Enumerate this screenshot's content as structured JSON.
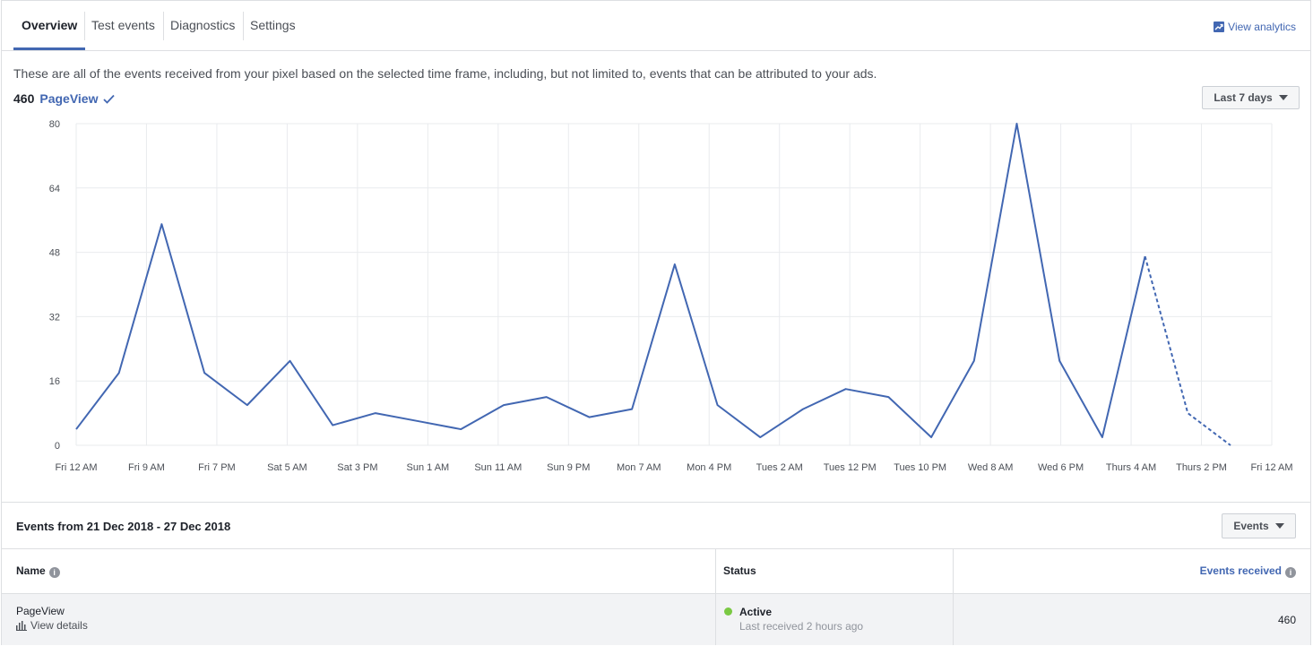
{
  "tabs": [
    {
      "label": "Overview",
      "active": true
    },
    {
      "label": "Test events",
      "active": false
    },
    {
      "label": "Diagnostics",
      "active": false
    },
    {
      "label": "Settings",
      "active": false
    }
  ],
  "header": {
    "view_analytics": "View analytics"
  },
  "description": "These are all of the events received from your pixel based on the selected time frame, including, but not limited to, events that can be attributed to your ads.",
  "summary": {
    "count": "460",
    "event": "PageView"
  },
  "timeframe_button": "Last 7 days",
  "accent_color": "#4267b2",
  "chart_data": {
    "type": "line",
    "x_tick_labels": [
      "Fri 12 AM",
      "Fri 9 AM",
      "Fri 7 PM",
      "Sat 5 AM",
      "Sat 3 PM",
      "Sun 1 AM",
      "Sun 11 AM",
      "Sun 9 PM",
      "Mon 7 AM",
      "Mon 4 PM",
      "Tues 2 AM",
      "Tues 12 PM",
      "Tues 10 PM",
      "Wed 8 AM",
      "Wed 6 PM",
      "Thurs 4 AM",
      "Thurs 2 PM",
      "Fri 12 AM"
    ],
    "y_ticks": [
      0,
      16,
      32,
      48,
      64,
      80
    ],
    "ylim": [
      0,
      80
    ],
    "grid": true,
    "series": [
      {
        "values": [
          4,
          18,
          55,
          18,
          10,
          21,
          5,
          8,
          6,
          4,
          10,
          12,
          7,
          9,
          45,
          10,
          2,
          9,
          14,
          12,
          2,
          21,
          80,
          21,
          2,
          47,
          8,
          0
        ],
        "dashed_from_index": 25
      }
    ]
  },
  "events_section": {
    "title": "Events from 21 Dec 2018 - 27 Dec 2018",
    "filter_button": "Events"
  },
  "table": {
    "columns": {
      "name": "Name",
      "status": "Status",
      "events_received": "Events received"
    },
    "rows": [
      {
        "name": "PageView",
        "details_link": "View details",
        "status": "Active",
        "status_sub": "Last received 2 hours ago",
        "events_received": "460"
      }
    ]
  }
}
